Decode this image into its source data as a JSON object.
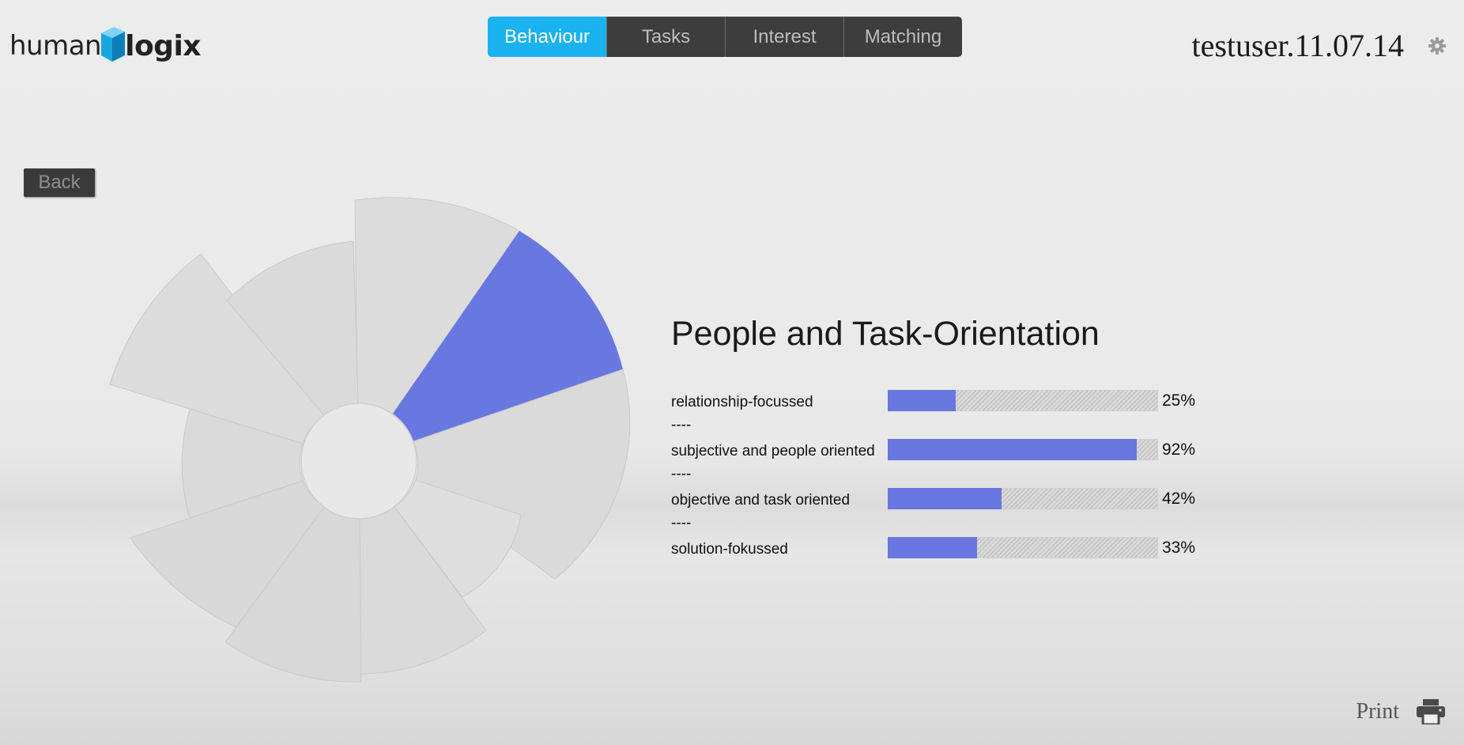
{
  "logo": {
    "part1": "human",
    "part2": "logix"
  },
  "tabs": [
    {
      "label": "Behaviour",
      "active": true
    },
    {
      "label": "Tasks",
      "active": false
    },
    {
      "label": "Interest",
      "active": false
    },
    {
      "label": "Matching",
      "active": false
    }
  ],
  "user": {
    "name": "testuser.11.07.14",
    "settings_icon": "gear-icon"
  },
  "back_label": "Back",
  "panel": {
    "title": "People and Task-Orientation",
    "separator": "----",
    "metrics": [
      {
        "label": "relationship-focussed",
        "value": 25,
        "display": "25%"
      },
      {
        "label": "subjective and people oriented",
        "value": 92,
        "display": "92%"
      },
      {
        "label": "objective and task oriented",
        "value": 42,
        "display": "42%"
      },
      {
        "label": "solution-fokussed",
        "value": 33,
        "display": "33%"
      }
    ]
  },
  "print": {
    "label": "Print",
    "icon": "printer-icon"
  },
  "colors": {
    "accent_tab": "#1ab3f0",
    "bar_fill": "#6878e0",
    "highlight_segment": "#6878e0",
    "segment_gray": "#dcdcdc"
  }
}
